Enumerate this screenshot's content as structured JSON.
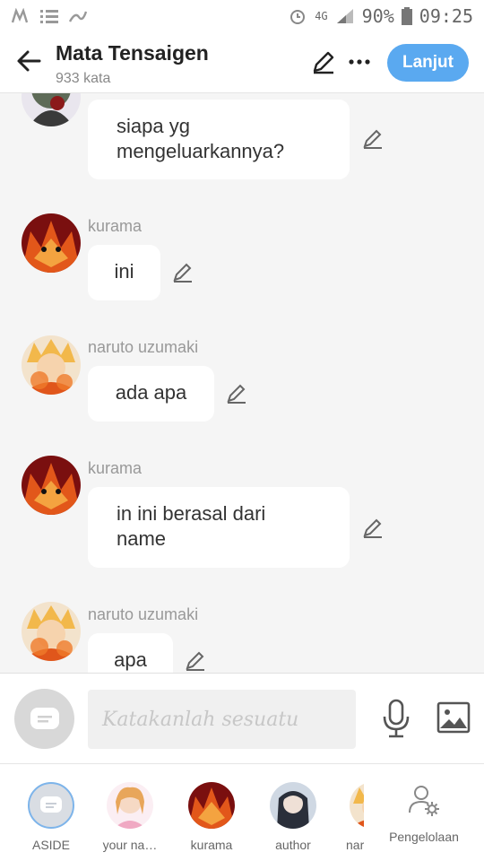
{
  "status_bar": {
    "battery": "90%",
    "time": "09:25",
    "network": "4G"
  },
  "header": {
    "title": "Mata Tensaigen",
    "subtitle": "933 kata",
    "next_label": "Lanjut"
  },
  "messages": [
    {
      "sender": "",
      "text_lines": [
        "siapa yg",
        "mengeluarkannya?"
      ],
      "avatar": "masked-character"
    },
    {
      "sender": "kurama",
      "text_lines": [
        "ini"
      ],
      "avatar": "kurama"
    },
    {
      "sender": "naruto uzumaki",
      "text_lines": [
        "ada apa"
      ],
      "avatar": "naruto"
    },
    {
      "sender": "kurama",
      "text_lines": [
        "in ini berasal dari",
        "name"
      ],
      "avatar": "kurama"
    },
    {
      "sender": "naruto uzumaki",
      "text_lines": [
        "apa"
      ],
      "avatar": "naruto"
    }
  ],
  "composer": {
    "placeholder": "Katakanlah sesuatu"
  },
  "characters": [
    {
      "name": "ASIDE",
      "avatar": "aside"
    },
    {
      "name": "your na…",
      "avatar": "anime-girl"
    },
    {
      "name": "kurama",
      "avatar": "kurama"
    },
    {
      "name": "author",
      "avatar": "dark-hair-girl"
    },
    {
      "name": "nar",
      "avatar": "naruto"
    }
  ],
  "manage_label": "Pengelolaan",
  "colors": {
    "accent": "#5aa9f0",
    "background": "#f5f5f5"
  },
  "icons": [
    "back-arrow-icon",
    "pencil-icon",
    "more-icon",
    "mic-icon",
    "image-icon",
    "chat-icon",
    "user-gear-icon"
  ]
}
